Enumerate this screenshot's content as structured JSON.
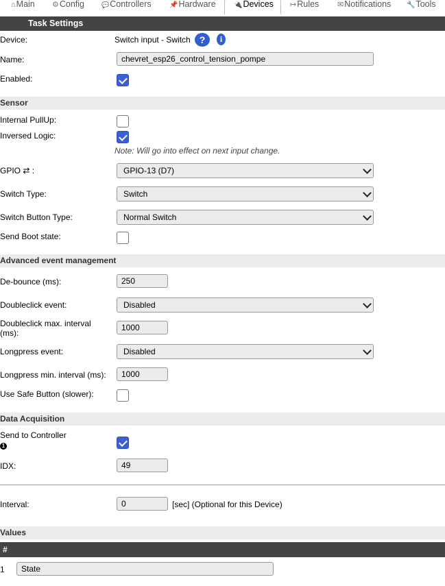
{
  "tabs": [
    {
      "icon": "⌂",
      "label": "Main"
    },
    {
      "icon": "⚙",
      "label": "Config"
    },
    {
      "icon": "💬",
      "label": "Controllers"
    },
    {
      "icon": "📌",
      "label": "Hardware"
    },
    {
      "icon": "🔌",
      "label": "Devices"
    },
    {
      "icon": "↦",
      "label": "Rules"
    },
    {
      "icon": "✉",
      "label": "Notifications"
    },
    {
      "icon": "🔧",
      "label": "Tools"
    }
  ],
  "task_settings": {
    "header": "Task Settings",
    "device_label": "Device:",
    "device_value": "Switch input - Switch",
    "help_glyph": "?",
    "info_glyph": "i",
    "name_label": "Name:",
    "name_value": "chevret_esp26_control_tension_pompe",
    "enabled_label": "Enabled:",
    "enabled_checked": true
  },
  "sensor": {
    "header": "Sensor",
    "pullup_label": "Internal PullUp:",
    "pullup_checked": false,
    "inversed_label": "Inversed Logic:",
    "inversed_checked": true,
    "note": "Note: Will go into effect on next input change.",
    "gpio_label": "GPIO ⇄ :",
    "gpio_value": "GPIO-13 (D7)",
    "switch_type_label": "Switch Type:",
    "switch_type_value": "Switch",
    "switch_button_type_label": "Switch Button Type:",
    "switch_button_type_value": "Normal Switch",
    "boot_state_label": "Send Boot state:",
    "boot_state_checked": false
  },
  "advanced": {
    "header": "Advanced event management",
    "debounce_label": "De-bounce (ms):",
    "debounce_value": "250",
    "doubleclick_label": "Doubleclick event:",
    "doubleclick_value": "Disabled",
    "doubleclick_interval_label": "Doubleclick max. interval (ms):",
    "doubleclick_interval_value": "1000",
    "longpress_label": "Longpress event:",
    "longpress_value": "Disabled",
    "longpress_interval_label": "Longpress min. interval (ms):",
    "longpress_interval_value": "1000",
    "safe_button_label": "Use Safe Button (slower):",
    "safe_button_checked": false
  },
  "data_acquisition": {
    "header": "Data Acquisition",
    "send_label": "Send to Controller",
    "send_badge": "1",
    "send_checked": true,
    "idx_label": "IDX:",
    "idx_value": "49",
    "interval_label": "Interval:",
    "interval_value": "0",
    "interval_suffix": "[sec] (Optional for this Device)"
  },
  "values": {
    "header": "Values",
    "col_hash": "#",
    "rows": [
      {
        "index": "1",
        "name": "State"
      }
    ]
  },
  "colors": {
    "header_bg": "#444444",
    "section_bg": "#ececec",
    "accent_blue": "#3b5fd6"
  }
}
